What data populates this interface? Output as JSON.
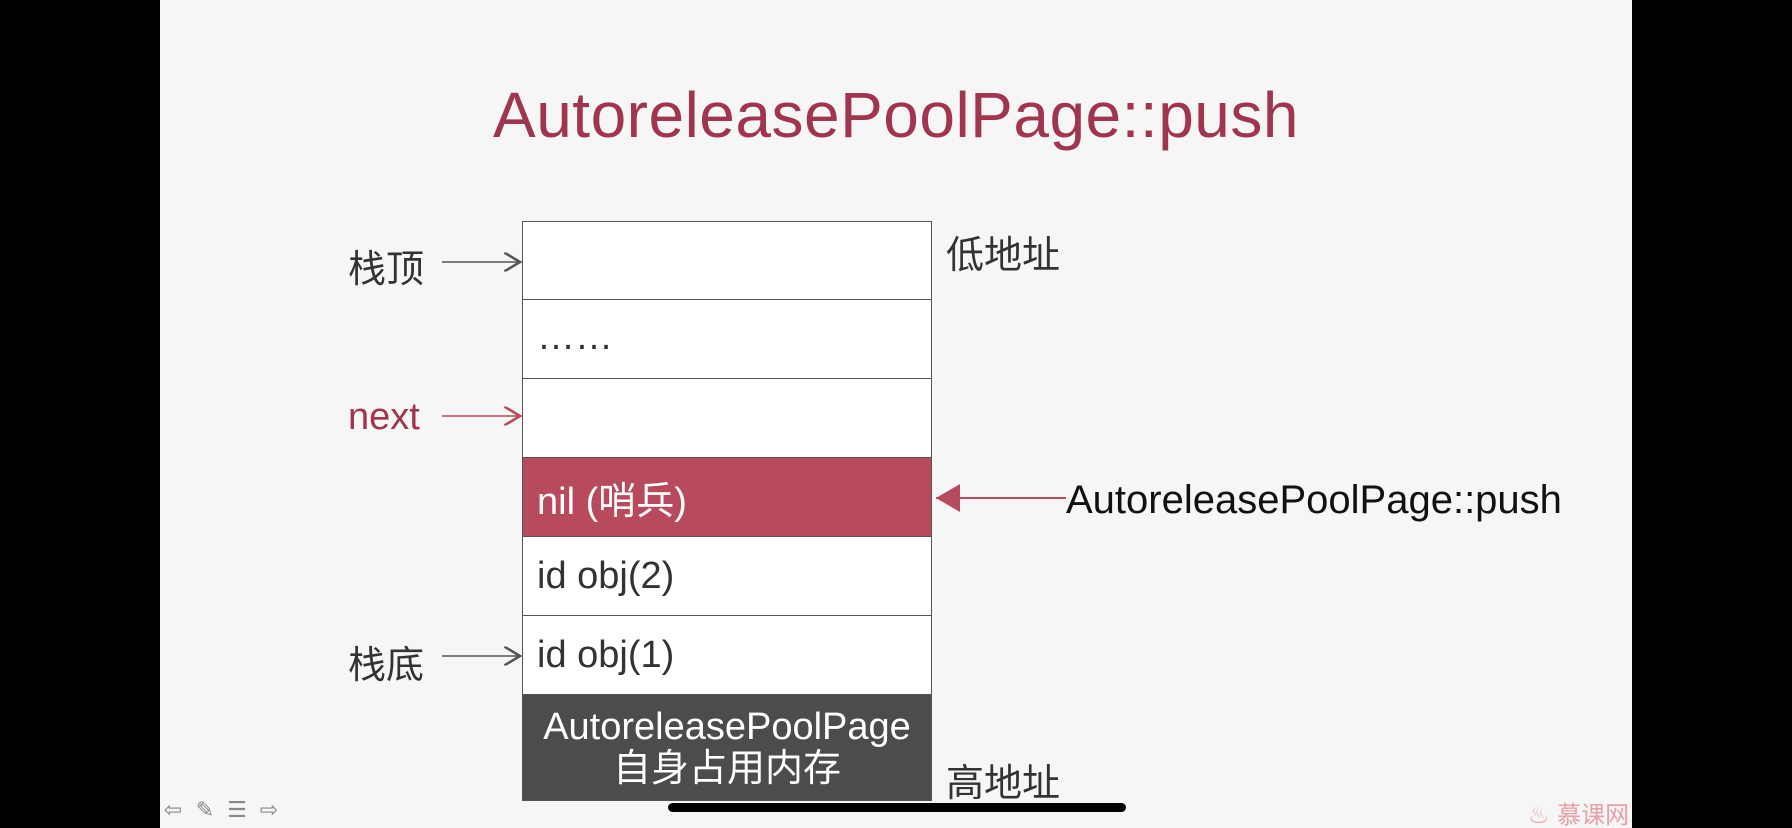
{
  "title": "AutoreleasePoolPage::push",
  "stack_cells": [
    "",
    "……",
    "",
    "nil (哨兵)",
    "id obj(2)",
    "id obj(1)"
  ],
  "page_block": {
    "line1": "AutoreleasePoolPage",
    "line2": "自身占用内存"
  },
  "labels": {
    "top": "栈顶",
    "next": "next",
    "bottom": "栈底"
  },
  "address": {
    "low": "低地址",
    "high": "高地址"
  },
  "pointer_label": "AutoreleasePoolPage::push",
  "colors": {
    "accent": "#a03550",
    "sentinel": "#b84a5d",
    "dark_block": "#4c4c4c"
  },
  "toolbar_icons": [
    "arrow-left-icon",
    "pen-icon",
    "menu-icon",
    "arrow-right-icon"
  ],
  "watermark": "慕课网"
}
